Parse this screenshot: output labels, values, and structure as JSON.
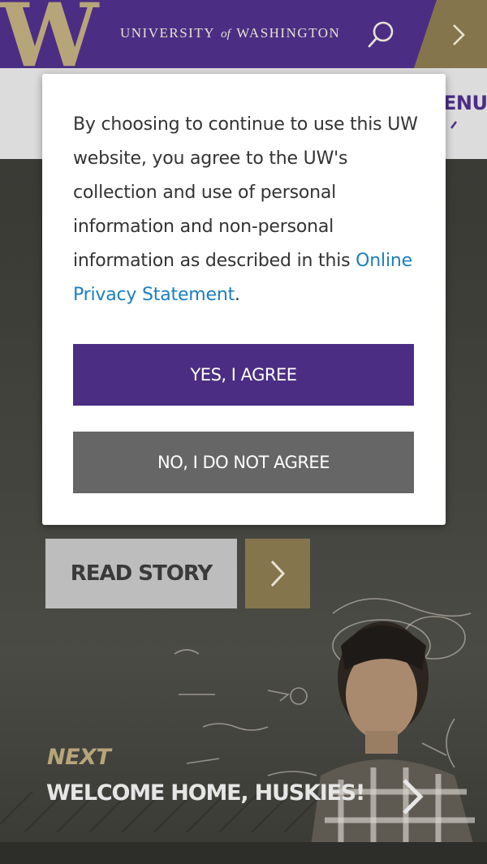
{
  "header": {
    "logo_letter": "W",
    "wordmark_pre": "UNIVERSITY",
    "wordmark_of": "of",
    "wordmark_post": "WASHINGTON",
    "search_icon": "search-icon",
    "arrow_icon": "chevron-right-icon"
  },
  "subnav": {
    "menu_label": "ENU"
  },
  "hero": {
    "read_story_label": "READ STORY",
    "next_label": "NEXT",
    "next_title": "WELCOME HOME, HUSKIES!"
  },
  "consent": {
    "text": "By choosing to continue to use this UW website, you agree to the UW's collection and use of personal information and non-personal information as described in this",
    "link_text": "Online Privacy Statement",
    "link_suffix": ".",
    "agree_label": "YES, I AGREE",
    "disagree_label": "NO, I DO NOT AGREE"
  },
  "colors": {
    "purple": "#4b2e83",
    "gold": "#85754d",
    "light_gold": "#b7a57a",
    "link": "#1a7fc1",
    "disagree_gray": "#666666"
  }
}
